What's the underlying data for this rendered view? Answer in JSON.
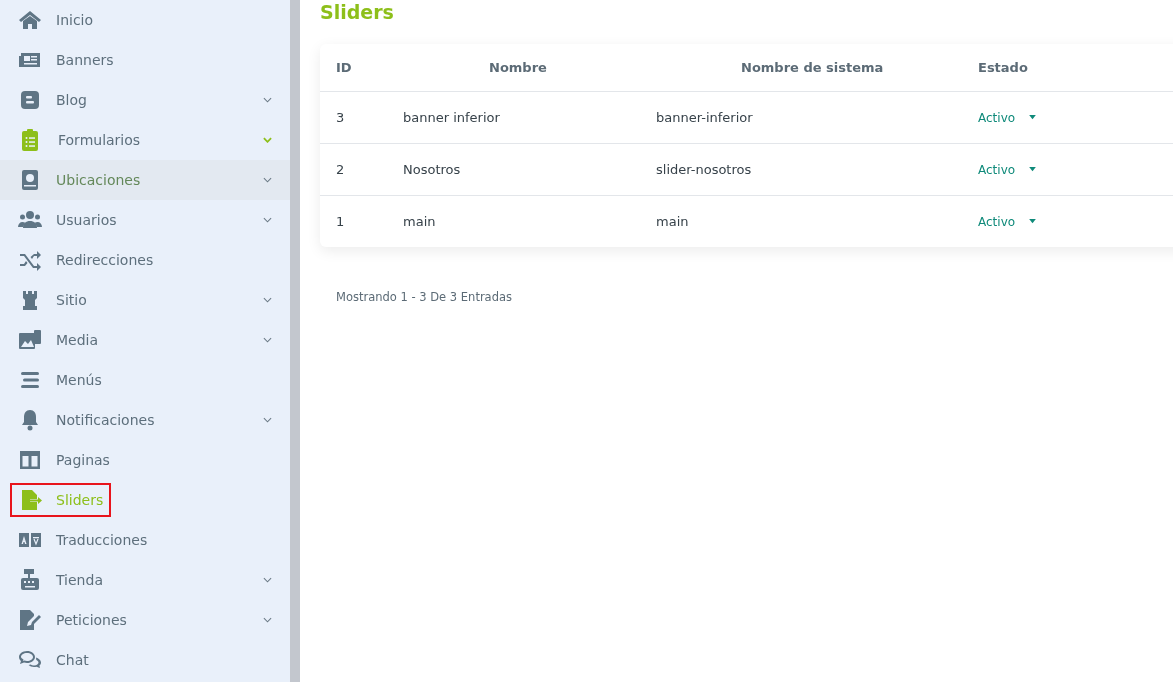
{
  "sidebar": {
    "items": [
      {
        "label": "Inicio",
        "kind": "home",
        "submenu": false,
        "selected": false,
        "hovered": false,
        "accent": false
      },
      {
        "label": "Banners",
        "kind": "newspaper",
        "submenu": false,
        "selected": false,
        "hovered": false,
        "accent": false
      },
      {
        "label": "Blog",
        "kind": "blog",
        "submenu": true,
        "selected": false,
        "hovered": false,
        "accent": false
      },
      {
        "label": "Formularios",
        "kind": "clipboard",
        "submenu": true,
        "selected": false,
        "hovered": false,
        "accent": true
      },
      {
        "label": "Ubicaciones",
        "kind": "atlas",
        "submenu": true,
        "selected": false,
        "hovered": true,
        "accent": false
      },
      {
        "label": "Usuarios",
        "kind": "users",
        "submenu": true,
        "selected": false,
        "hovered": false,
        "accent": false
      },
      {
        "label": "Redirecciones",
        "kind": "shuffle",
        "submenu": false,
        "selected": false,
        "hovered": false,
        "accent": false
      },
      {
        "label": "Sitio",
        "kind": "tower",
        "submenu": true,
        "selected": false,
        "hovered": false,
        "accent": false
      },
      {
        "label": "Media",
        "kind": "photo",
        "submenu": true,
        "selected": false,
        "hovered": false,
        "accent": false
      },
      {
        "label": "Menús",
        "kind": "bars",
        "submenu": false,
        "selected": false,
        "hovered": false,
        "accent": false
      },
      {
        "label": "Notificaciones",
        "kind": "bell",
        "submenu": true,
        "selected": false,
        "hovered": false,
        "accent": false
      },
      {
        "label": "Paginas",
        "kind": "columns",
        "submenu": false,
        "selected": false,
        "hovered": false,
        "accent": false
      },
      {
        "label": "Sliders",
        "kind": "export",
        "submenu": false,
        "selected": true,
        "hovered": false,
        "accent": false
      },
      {
        "label": "Traducciones",
        "kind": "language",
        "submenu": false,
        "selected": false,
        "hovered": false,
        "accent": false
      },
      {
        "label": "Tienda",
        "kind": "register",
        "submenu": true,
        "selected": false,
        "hovered": false,
        "accent": false
      },
      {
        "label": "Peticiones",
        "kind": "signature",
        "submenu": true,
        "selected": false,
        "hovered": false,
        "accent": false
      },
      {
        "label": "Chat",
        "kind": "comments",
        "submenu": false,
        "selected": false,
        "hovered": false,
        "accent": false
      }
    ]
  },
  "page": {
    "title": "Sliders"
  },
  "table": {
    "columns": [
      "ID",
      "Nombre",
      "Nombre de sistema",
      "Estado"
    ],
    "rows": [
      {
        "id": "3",
        "name": "banner inferior",
        "system_name": "banner-inferior",
        "status": "Activo"
      },
      {
        "id": "2",
        "name": "Nosotros",
        "system_name": "slider-nosotros",
        "status": "Activo"
      },
      {
        "id": "1",
        "name": "main",
        "system_name": "main",
        "status": "Activo"
      }
    ]
  },
  "footer": {
    "summary": "Mostrando 1 - 3 De 3 Entradas"
  }
}
